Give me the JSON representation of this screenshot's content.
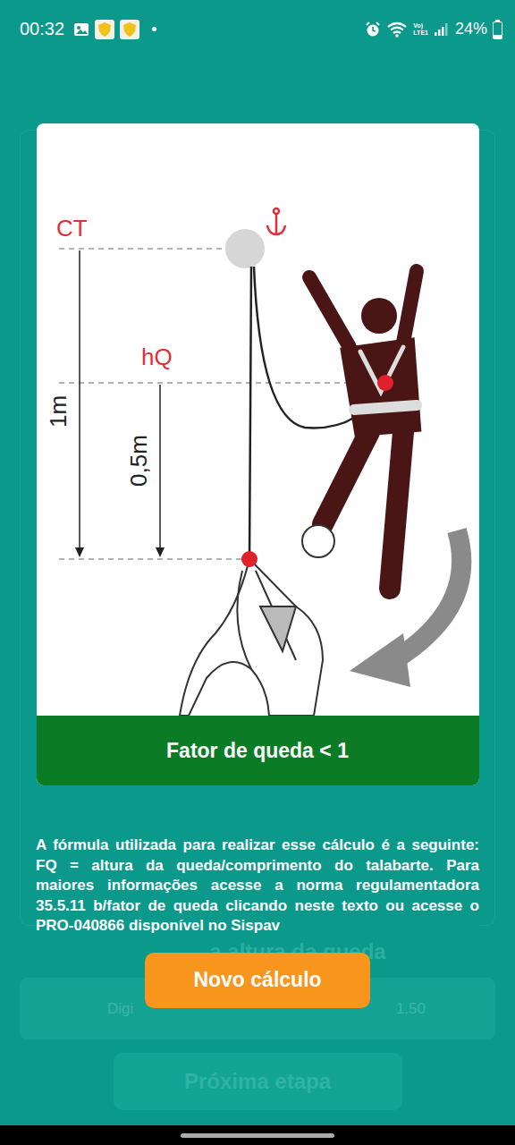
{
  "status_bar": {
    "time": "00:32",
    "network": [
      "Vo)",
      "LTE1"
    ],
    "battery": "24%",
    "battery_level": 0.24
  },
  "background": {
    "label": "a altura da queda",
    "input_placeholder": "Digi",
    "input_value": "1.50",
    "button": "Próxima etapa"
  },
  "dialog": {
    "diagram": {
      "anchor_label": "CT",
      "hq_label": "hQ",
      "total_height": "1m",
      "partial_height": "0,5m"
    },
    "result": "Fator de queda < 1",
    "description": "A fórmula utilizada para realizar esse cálculo é a seguinte: FQ = altura da queda/comprimento do talabarte. Para maiores informações acesse a norma regulamentadora 35.5.11 b/fator de queda clicando neste texto ou acesse o PRO-040866 disponível no Sispav",
    "button": "Novo cálculo"
  }
}
